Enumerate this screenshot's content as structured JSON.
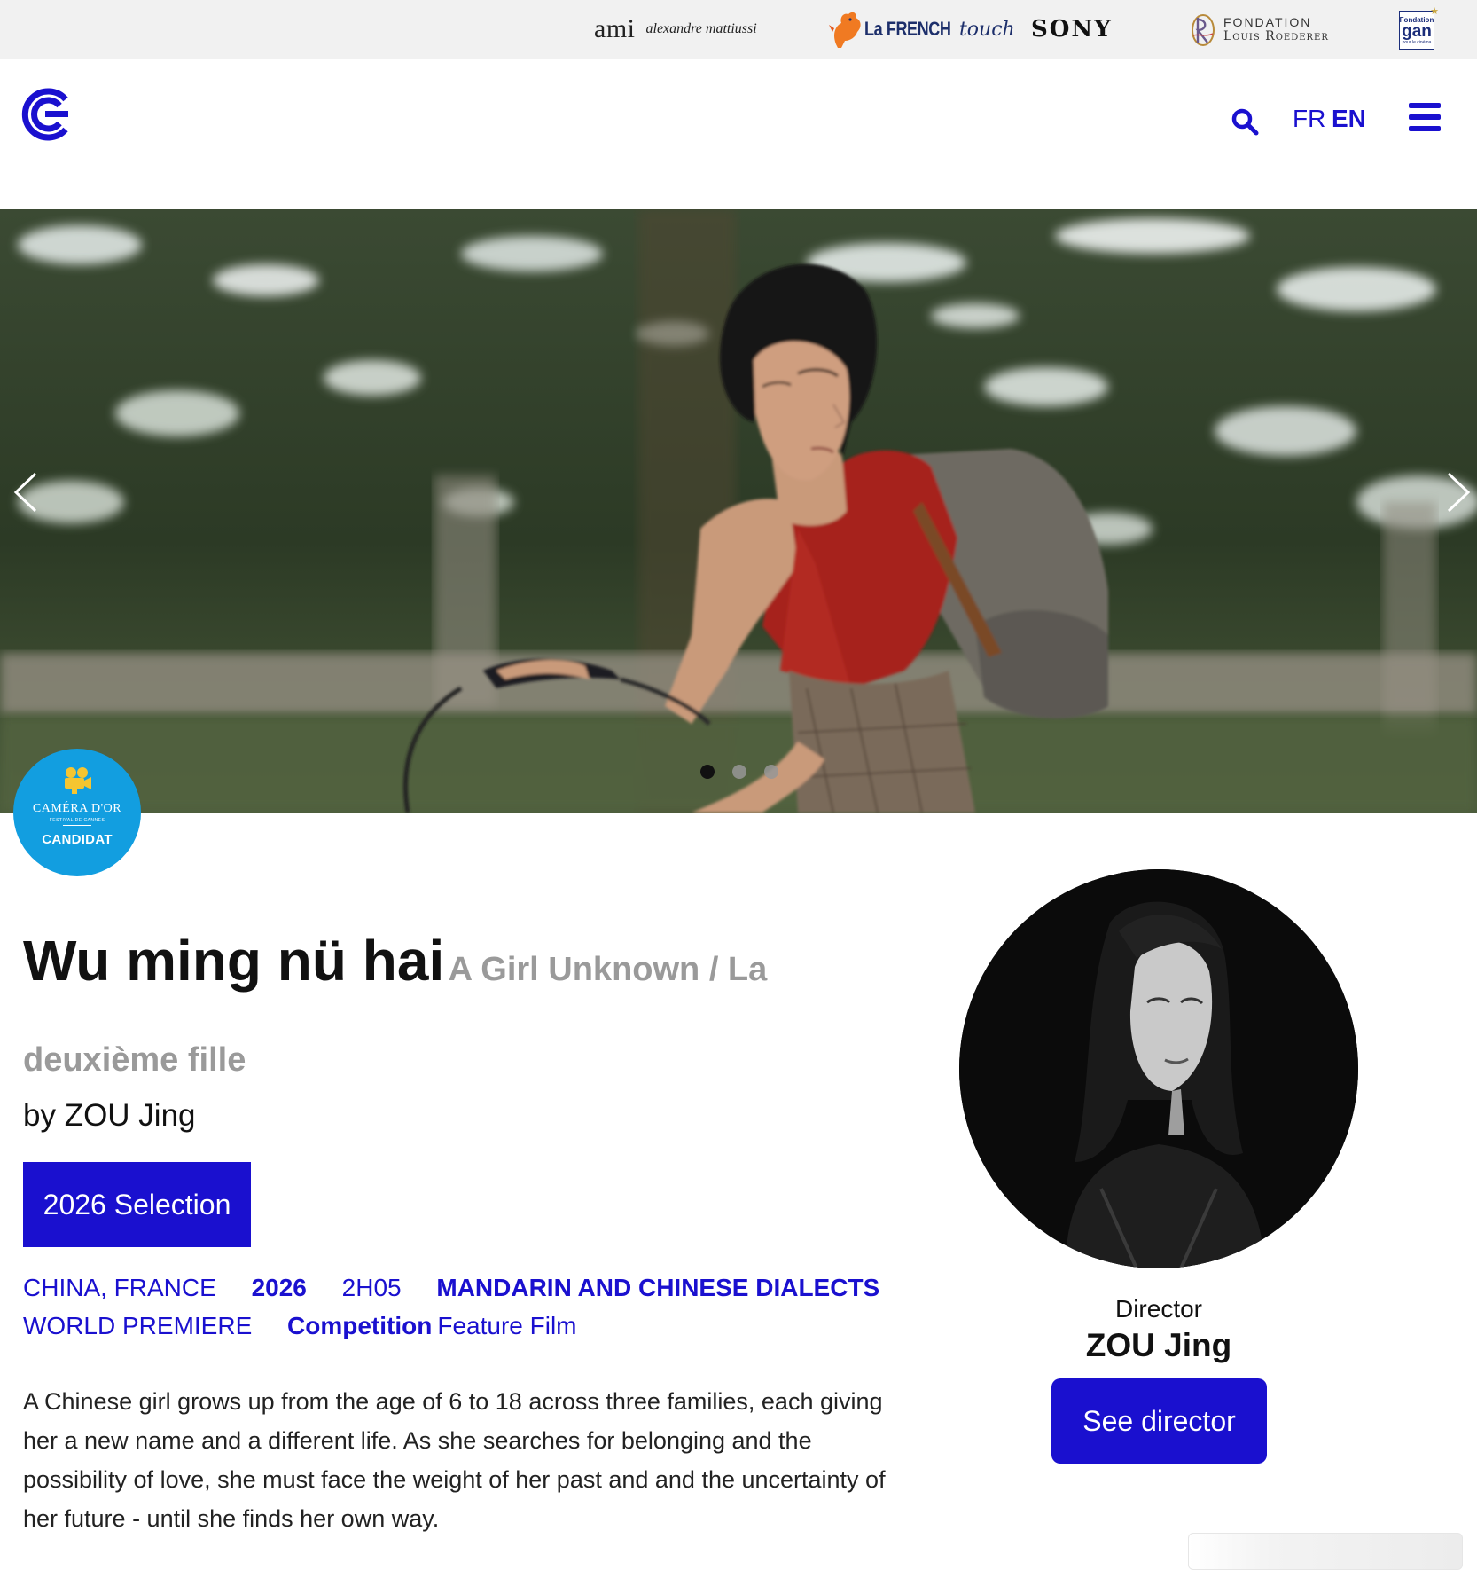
{
  "sponsors": {
    "ami_main": "ami",
    "ami_sub": "alexandre mattiussi",
    "french_touch_main": "La FRENCH",
    "french_touch_script": "touch",
    "sony": "SONY",
    "roederer_line1": "FONDATION",
    "roederer_line2": "Louis Roederer",
    "gan_line1": "Fondation",
    "gan_line2": "gan",
    "gan_line3": "pour le cinéma"
  },
  "header": {
    "lang_fr": "FR",
    "lang_en": "EN"
  },
  "badge": {
    "line1": "CAMÉRA D'OR",
    "line2": "FESTIVAL DE CANNES",
    "line3": "CANDIDAT"
  },
  "film": {
    "title": "Wu ming nü hai",
    "alt_titles": "A Girl Unknown / La deuxième fille",
    "byline": "by ZOU Jing",
    "selection_label": "2026 Selection",
    "countries": "CHINA, FRANCE",
    "year": "2026",
    "duration": "2H05",
    "languages": "MANDARIN AND CHINESE DIALECTS",
    "premiere": "WORLD PREMIERE",
    "section": "Competition",
    "category": "Feature Film",
    "synopsis": "A Chinese girl grows up from the age of 6 to 18 across three families, each giving her a new name and a different life. As she searches for belonging and the possibility of love, she must face the weight of her past and and the uncertainty of her future - until she finds her own way."
  },
  "director": {
    "role": "Director",
    "name": "ZOU Jing",
    "button_label": "See director"
  },
  "carousel": {
    "slide_count": 3,
    "active_slide": 1
  },
  "colors": {
    "accent": "#1a10cf",
    "badge": "#129ee0",
    "muted_title": "#9a9a9a",
    "sponsor_bar": "#f1f1f1"
  },
  "icons": {
    "logo": "festival-logo-icon",
    "search": "search-icon",
    "menu": "hamburger-menu-icon",
    "prev": "chevron-left-icon",
    "next": "chevron-right-icon"
  }
}
